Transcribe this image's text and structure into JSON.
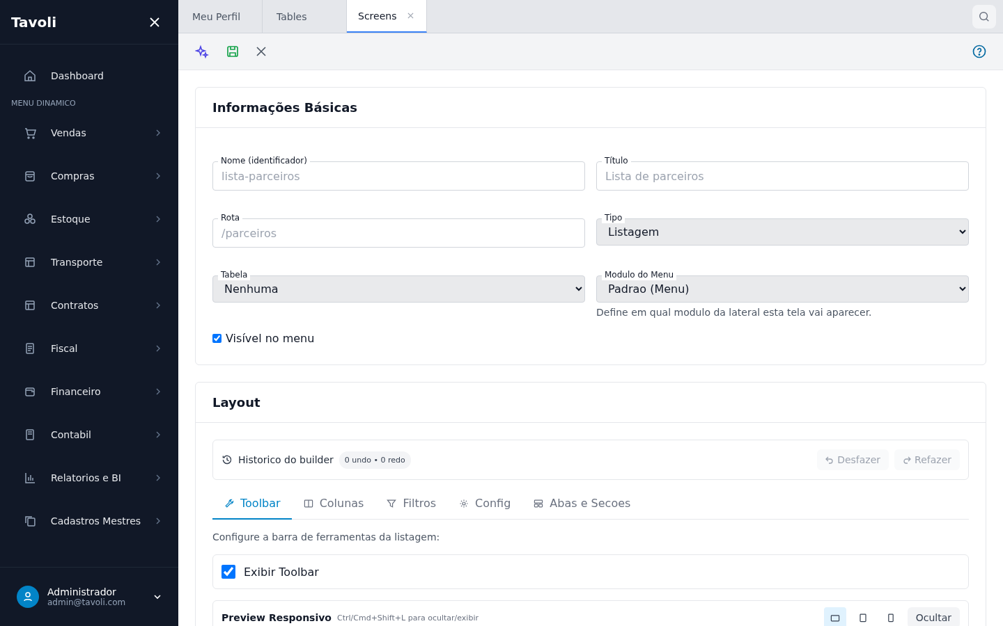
{
  "sidebar": {
    "brand": "Tavoli",
    "home": {
      "label": "Dashboard"
    },
    "section_label": "MENU DINAMICO",
    "items": [
      {
        "label": "Vendas",
        "expanded": false
      },
      {
        "label": "Compras",
        "expanded": false
      },
      {
        "label": "Estoque",
        "expanded": false
      },
      {
        "label": "Transporte",
        "expanded": false
      },
      {
        "label": "Contratos",
        "expanded": false
      },
      {
        "label": "Fiscal",
        "expanded": false
      },
      {
        "label": "Financeiro",
        "expanded": false
      },
      {
        "label": "Contabil",
        "expanded": false
      },
      {
        "label": "Relatorios e BI",
        "expanded": false
      },
      {
        "label": "Cadastros Mestres",
        "expanded": false
      }
    ],
    "user": {
      "name": "Administrador",
      "email": "admin@tavoli.com"
    }
  },
  "tabs": [
    {
      "label": "Meu Perfil",
      "selected": false,
      "closable": false
    },
    {
      "label": "Tables",
      "selected": false,
      "closable": false
    },
    {
      "label": "Screens",
      "selected": true,
      "closable": true
    }
  ],
  "basic": {
    "title": "Informações Básicas",
    "fields": [
      {
        "kind": "text",
        "label": "Nome (identificador)",
        "placeholder": "lista-parceiros"
      },
      {
        "kind": "text",
        "label": "Título",
        "placeholder": "Lista de parceiros"
      },
      {
        "kind": "text",
        "label": "Rota",
        "placeholder": "/parceiros"
      },
      {
        "kind": "select",
        "label": "Tipo",
        "value": "Listagem"
      },
      {
        "kind": "select",
        "label": "Tabela",
        "value": "Nenhuma"
      },
      {
        "kind": "select",
        "label": "Modulo do Menu",
        "value": "Padrao (Menu)",
        "help": "Define em qual modulo da lateral esta tela vai aparecer."
      }
    ],
    "visible": {
      "label": "Visível no menu",
      "checked": true
    }
  },
  "layout": {
    "title": "Layout",
    "history": {
      "label": "Historico do builder",
      "badge": "0 undo • 0 redo",
      "undo": "Desfazer",
      "redo": "Refazer",
      "disabled": true
    },
    "tabs": [
      {
        "label": "Toolbar",
        "selected": true
      },
      {
        "label": "Colunas",
        "selected": false
      },
      {
        "label": "Filtros",
        "selected": false
      },
      {
        "label": "Config",
        "selected": false
      },
      {
        "label": "Abas e Secoes",
        "selected": false
      }
    ],
    "intro": "Configure a barra de ferramentas da listagem:",
    "show_toolbar": {
      "label": "Exibir Toolbar",
      "checked": true
    },
    "preview": {
      "title": "Preview Responsivo",
      "hint": "Ctrl/Cmd+Shift+L para ocultar/exibir",
      "devices": [
        {
          "selected": true
        },
        {
          "selected": false
        },
        {
          "selected": false
        }
      ],
      "hide": "Ocultar"
    }
  }
}
